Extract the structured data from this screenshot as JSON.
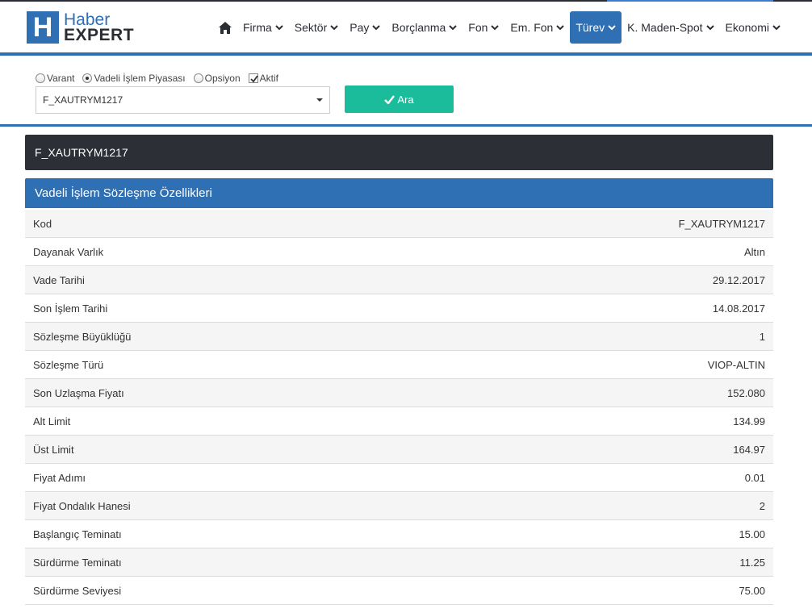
{
  "logo": {
    "box": "H",
    "line1": "Haber",
    "line2": "EXPERT"
  },
  "nav": {
    "items": [
      {
        "label": "Firma"
      },
      {
        "label": "Sektör"
      },
      {
        "label": "Pay"
      },
      {
        "label": "Borçlanma"
      },
      {
        "label": "Fon"
      },
      {
        "label": "Em. Fon"
      },
      {
        "label": "Türev",
        "active": true
      },
      {
        "label": "K. Maden-Spot"
      },
      {
        "label": "Ekonomi"
      }
    ]
  },
  "filters": {
    "options": [
      {
        "label": "Varant",
        "checked": false
      },
      {
        "label": "Vadeli İşlem Piyasası",
        "checked": true
      },
      {
        "label": "Opsiyon",
        "checked": false
      }
    ],
    "active_checkbox": {
      "label": "Aktif",
      "checked": true
    },
    "select_value": "F_XAUTRYM1217",
    "search_label": "Ara"
  },
  "instrument_title": "F_XAUTRYM1217",
  "section_title": "Vadeli İşlem Sözleşme Özellikleri",
  "properties": [
    {
      "label": "Kod",
      "value": "F_XAUTRYM1217"
    },
    {
      "label": "Dayanak Varlık",
      "value": "Altın"
    },
    {
      "label": "Vade Tarihi",
      "value": "29.12.2017"
    },
    {
      "label": "Son İşlem Tarihi",
      "value": "14.08.2017"
    },
    {
      "label": "Sözleşme Büyüklüğü",
      "value": "1"
    },
    {
      "label": "Sözleşme Türü",
      "value": "VIOP-ALTIN"
    },
    {
      "label": "Son Uzlaşma Fiyatı",
      "value": "152.080"
    },
    {
      "label": "Alt Limit",
      "value": "134.99"
    },
    {
      "label": "Üst Limit",
      "value": "164.97"
    },
    {
      "label": "Fiyat Adımı",
      "value": "0.01"
    },
    {
      "label": "Fiyat Ondalık Hanesi",
      "value": "2"
    },
    {
      "label": "Başlangıç Teminatı",
      "value": "15.00"
    },
    {
      "label": "Sürdürme Teminatı",
      "value": "11.25"
    },
    {
      "label": "Sürdürme Seviyesi",
      "value": "75.00"
    }
  ],
  "colors": {
    "brand": "#2f6fb3",
    "dark": "#2d2f36",
    "button": "#1abc9c"
  }
}
